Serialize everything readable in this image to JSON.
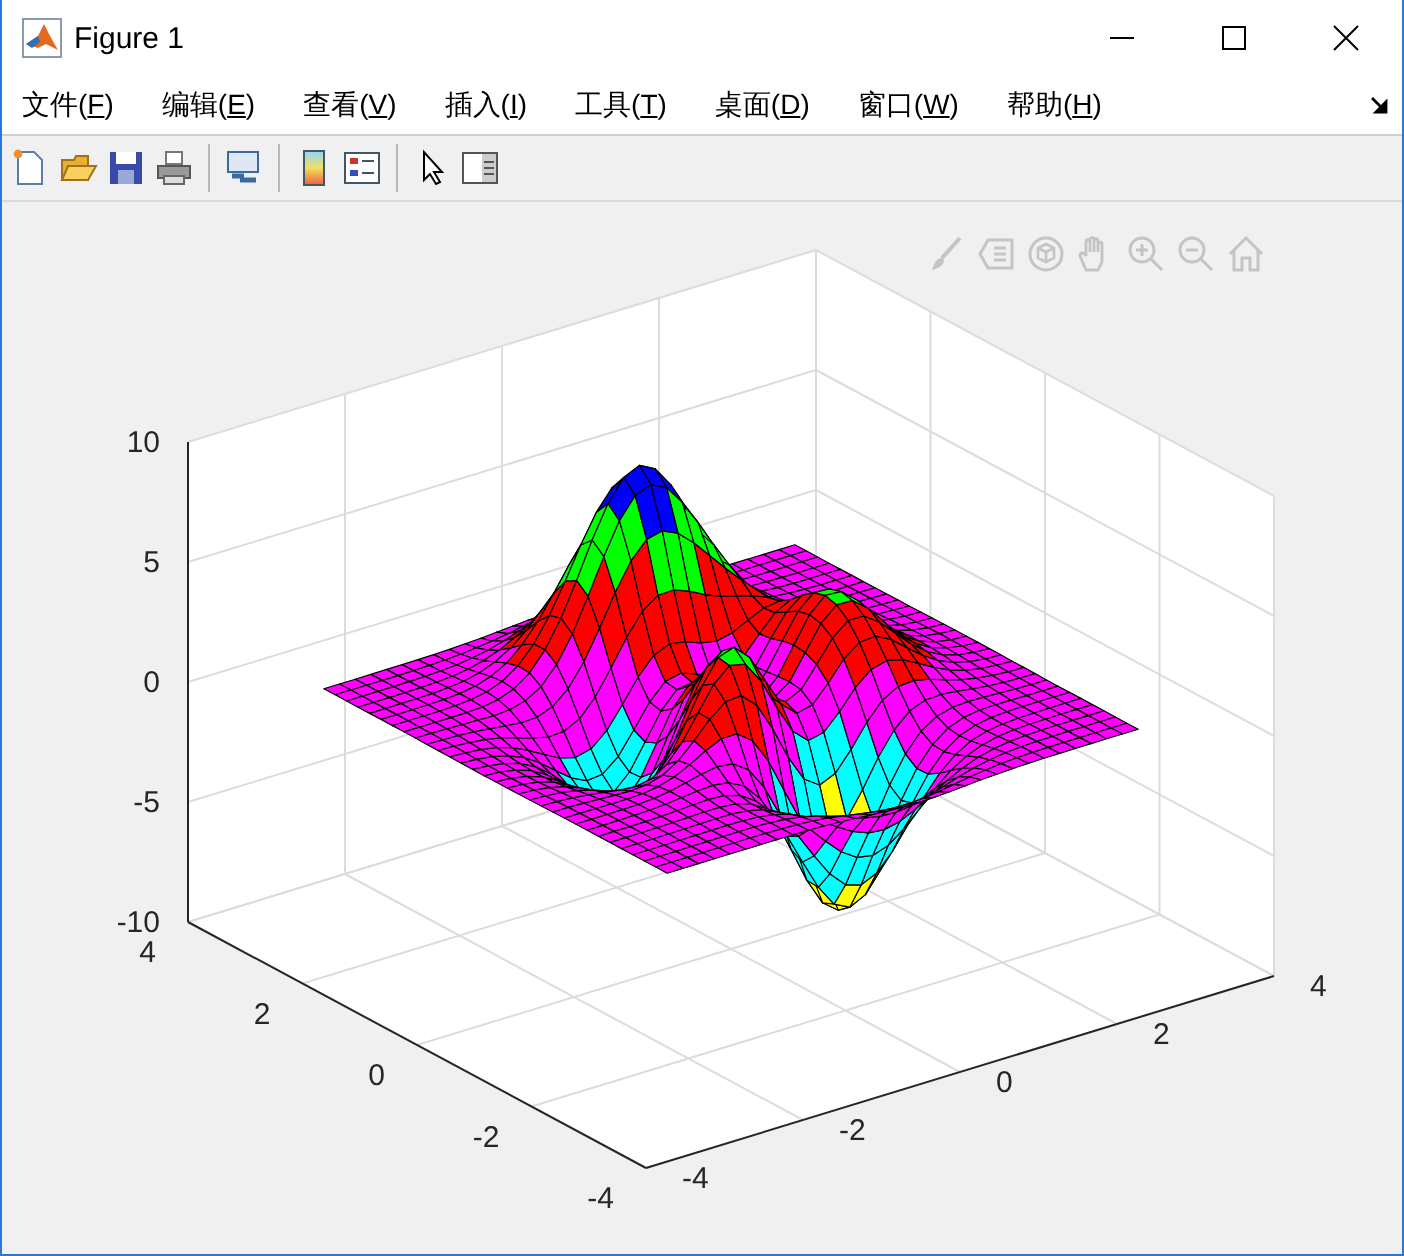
{
  "window": {
    "title": "Figure 1"
  },
  "menu": [
    {
      "prefix": "文件(",
      "mnemonic": "F",
      "suffix": ")"
    },
    {
      "prefix": "编辑(",
      "mnemonic": "E",
      "suffix": ")"
    },
    {
      "prefix": "查看(",
      "mnemonic": "V",
      "suffix": ")"
    },
    {
      "prefix": "插入(",
      "mnemonic": "I",
      "suffix": ")"
    },
    {
      "prefix": "工具(",
      "mnemonic": "T",
      "suffix": ")"
    },
    {
      "prefix": "桌面(",
      "mnemonic": "D",
      "suffix": ")"
    },
    {
      "prefix": "窗口(",
      "mnemonic": "W",
      "suffix": ")"
    },
    {
      "prefix": "帮助(",
      "mnemonic": "H",
      "suffix": ")"
    }
  ],
  "toolbar": [
    {
      "kind": "new"
    },
    {
      "kind": "open"
    },
    {
      "kind": "save"
    },
    {
      "kind": "print"
    },
    {
      "kind": "separator"
    },
    {
      "kind": "link"
    },
    {
      "kind": "separator"
    },
    {
      "kind": "colorbar"
    },
    {
      "kind": "legend"
    },
    {
      "kind": "separator"
    },
    {
      "kind": "pointer"
    },
    {
      "kind": "inspector"
    }
  ],
  "axes_toolbar": [
    {
      "kind": "brush"
    },
    {
      "kind": "datatip"
    },
    {
      "kind": "rotate"
    },
    {
      "kind": "pan"
    },
    {
      "kind": "zoom-in"
    },
    {
      "kind": "zoom-out"
    },
    {
      "kind": "home"
    }
  ],
  "plot": {
    "z_ticks": [
      "10",
      "5",
      "0",
      "-5",
      "-10"
    ],
    "y_ticks": [
      "4",
      "2",
      "0",
      "-2",
      "-4"
    ],
    "x_ticks": [
      "-4",
      "-2",
      "0",
      "2",
      "4"
    ]
  }
}
